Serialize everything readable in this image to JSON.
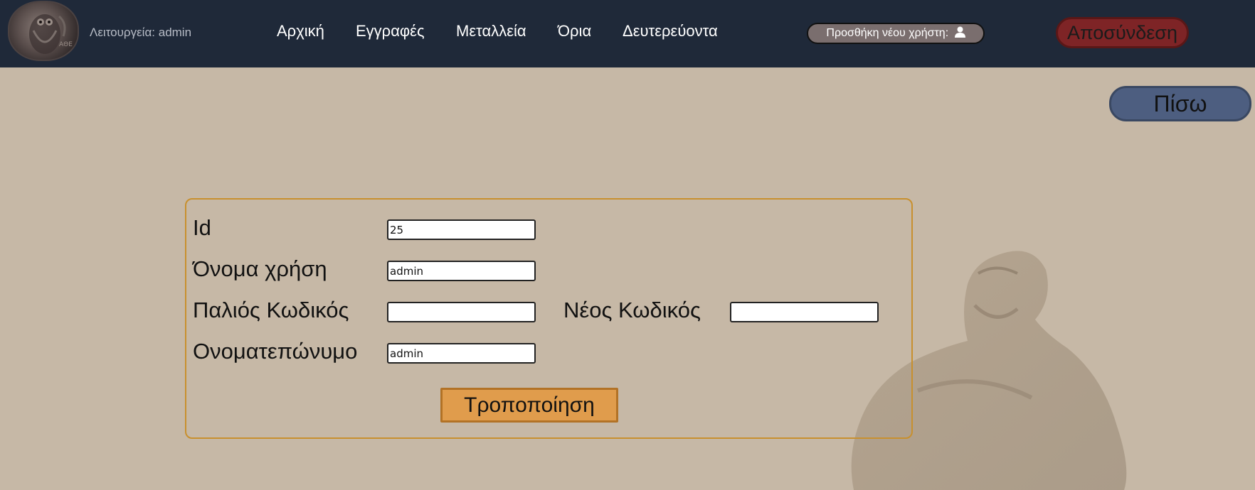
{
  "header": {
    "mode_label": "Λειτουργεία: admin",
    "nav": [
      "Αρχική",
      "Εγγραφές",
      "Μεταλλεία",
      "Όρια",
      "Δευτερεύοντα"
    ],
    "add_user_label": "Προσθήκη νέου χρήστη:",
    "add_user_icon": "user-icon",
    "logout_label": "Αποσύνδεση"
  },
  "back_label": "Πίσω",
  "form": {
    "id_label": "Id",
    "id_value": "25",
    "username_label": "Όνομα χρήση",
    "username_value": "admin",
    "old_password_label": "Παλιός Κωδικός",
    "old_password_value": "",
    "new_password_label": "Νέος Κωδικός",
    "new_password_value": "",
    "fullname_label": "Ονοματεπώνυμο",
    "fullname_value": "admin",
    "submit_label": "Τροποποίηση"
  },
  "colors": {
    "header_bg": "#1f2939",
    "page_bg": "#c6b8a6",
    "logout_bg": "#7e2426",
    "back_bg": "#4d5e80",
    "submit_bg": "#e09c4c",
    "form_border": "#c8902e"
  }
}
